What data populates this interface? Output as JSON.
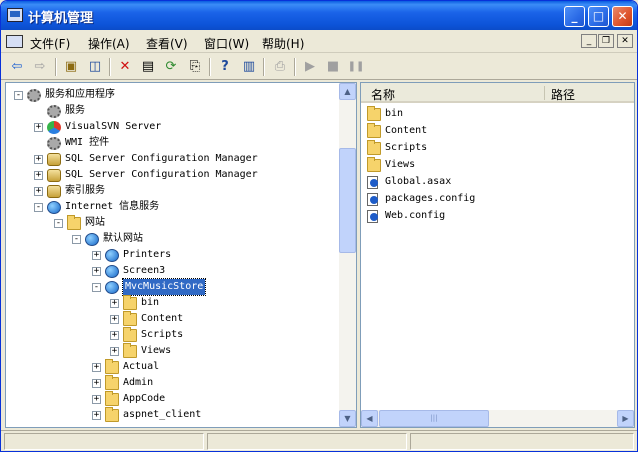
{
  "window": {
    "title": "计算机管理",
    "minimize_label": "_",
    "maximize_label": "□",
    "close_label": "✕"
  },
  "menubar": {
    "items": [
      "文件(F)",
      "操作(A)",
      "查看(V)",
      "窗口(W)",
      "帮助(H)"
    ]
  },
  "mdi_controls": [
    "_",
    "❐",
    "✕"
  ],
  "toolbar": {
    "buttons": [
      {
        "name": "back-button",
        "glyph": "⇦",
        "enabled": true
      },
      {
        "name": "forward-button",
        "glyph": "⇨",
        "enabled": false
      },
      {
        "name": "up-level-button",
        "glyph": "▣",
        "enabled": true
      },
      {
        "name": "show-hide-tree-button",
        "glyph": "◫",
        "enabled": true
      },
      {
        "name": "delete-button",
        "glyph": "✕",
        "enabled": true
      },
      {
        "name": "properties-button",
        "glyph": "▤",
        "enabled": true
      },
      {
        "name": "refresh-button",
        "glyph": "⟳",
        "enabled": true
      },
      {
        "name": "export-list-button",
        "glyph": "⎘",
        "enabled": true
      },
      {
        "name": "help-button",
        "glyph": "?",
        "enabled": true
      },
      {
        "name": "action-pane-button",
        "glyph": "▥",
        "enabled": true
      },
      {
        "name": "connect-button",
        "glyph": "⎙",
        "enabled": false
      },
      {
        "name": "start-button",
        "glyph": "▶",
        "enabled": false
      },
      {
        "name": "stop-button",
        "glyph": "■",
        "enabled": false
      },
      {
        "name": "pause-button",
        "glyph": "❚❚",
        "enabled": false
      }
    ]
  },
  "tree": {
    "items": [
      {
        "label": "服务和应用程序",
        "icon": "services-apps-icon",
        "toggle": "-"
      },
      {
        "label": "服务",
        "icon": "gear-icon",
        "toggle": ""
      },
      {
        "label": "VisualSVN Server",
        "icon": "visualsvn-icon",
        "toggle": "+"
      },
      {
        "label": "WMI 控件",
        "icon": "wmi-icon",
        "toggle": ""
      },
      {
        "label": "SQL Server Configuration Manager",
        "icon": "sql-server-icon",
        "toggle": "+"
      },
      {
        "label": "SQL Server Configuration Manager",
        "icon": "sql-server-icon",
        "toggle": "+"
      },
      {
        "label": "索引服务",
        "icon": "indexing-icon",
        "toggle": "+"
      },
      {
        "label": "Internet 信息服务",
        "icon": "iis-icon",
        "toggle": "-"
      },
      {
        "label": "网站",
        "icon": "folder-icon",
        "toggle": "-"
      },
      {
        "label": "默认网站",
        "icon": "website-icon",
        "toggle": "-"
      },
      {
        "label": "Printers",
        "icon": "virtual-dir-icon",
        "toggle": "+"
      },
      {
        "label": "Screen3",
        "icon": "virtual-dir-icon",
        "toggle": "+"
      },
      {
        "label": "MvcMusicStore",
        "icon": "virtual-dir-icon",
        "toggle": "-",
        "selected": true
      },
      {
        "label": "bin",
        "icon": "folder-icon",
        "toggle": "+"
      },
      {
        "label": "Content",
        "icon": "folder-icon",
        "toggle": "+"
      },
      {
        "label": "Scripts",
        "icon": "folder-icon",
        "toggle": "+"
      },
      {
        "label": "Views",
        "icon": "folder-icon",
        "toggle": "+"
      },
      {
        "label": "Actual",
        "icon": "folder-icon",
        "toggle": "+"
      },
      {
        "label": "Admin",
        "icon": "folder-icon",
        "toggle": "+"
      },
      {
        "label": "AppCode",
        "icon": "folder-icon",
        "toggle": "+"
      },
      {
        "label": "aspnet_client",
        "icon": "folder-icon",
        "toggle": "+"
      }
    ]
  },
  "list": {
    "columns": [
      "名称",
      "路径"
    ],
    "rows": [
      {
        "name": "bin",
        "icon": "folder-icon"
      },
      {
        "name": "Content",
        "icon": "folder-icon"
      },
      {
        "name": "Scripts",
        "icon": "folder-icon"
      },
      {
        "name": "Views",
        "icon": "folder-icon"
      },
      {
        "name": "Global.asax",
        "icon": "aspx-file-icon"
      },
      {
        "name": "packages.config",
        "icon": "aspx-file-icon"
      },
      {
        "name": "Web.config",
        "icon": "aspx-file-icon"
      }
    ]
  },
  "scrollbar": {
    "up_arrow": "▲",
    "down_arrow": "▼",
    "left_arrow": "◀",
    "right_arrow": "▶",
    "grip": "|||"
  },
  "colors": {
    "titlebar": "#0b54d8",
    "selection": "#316ac5",
    "close_button": "#e0572f"
  }
}
